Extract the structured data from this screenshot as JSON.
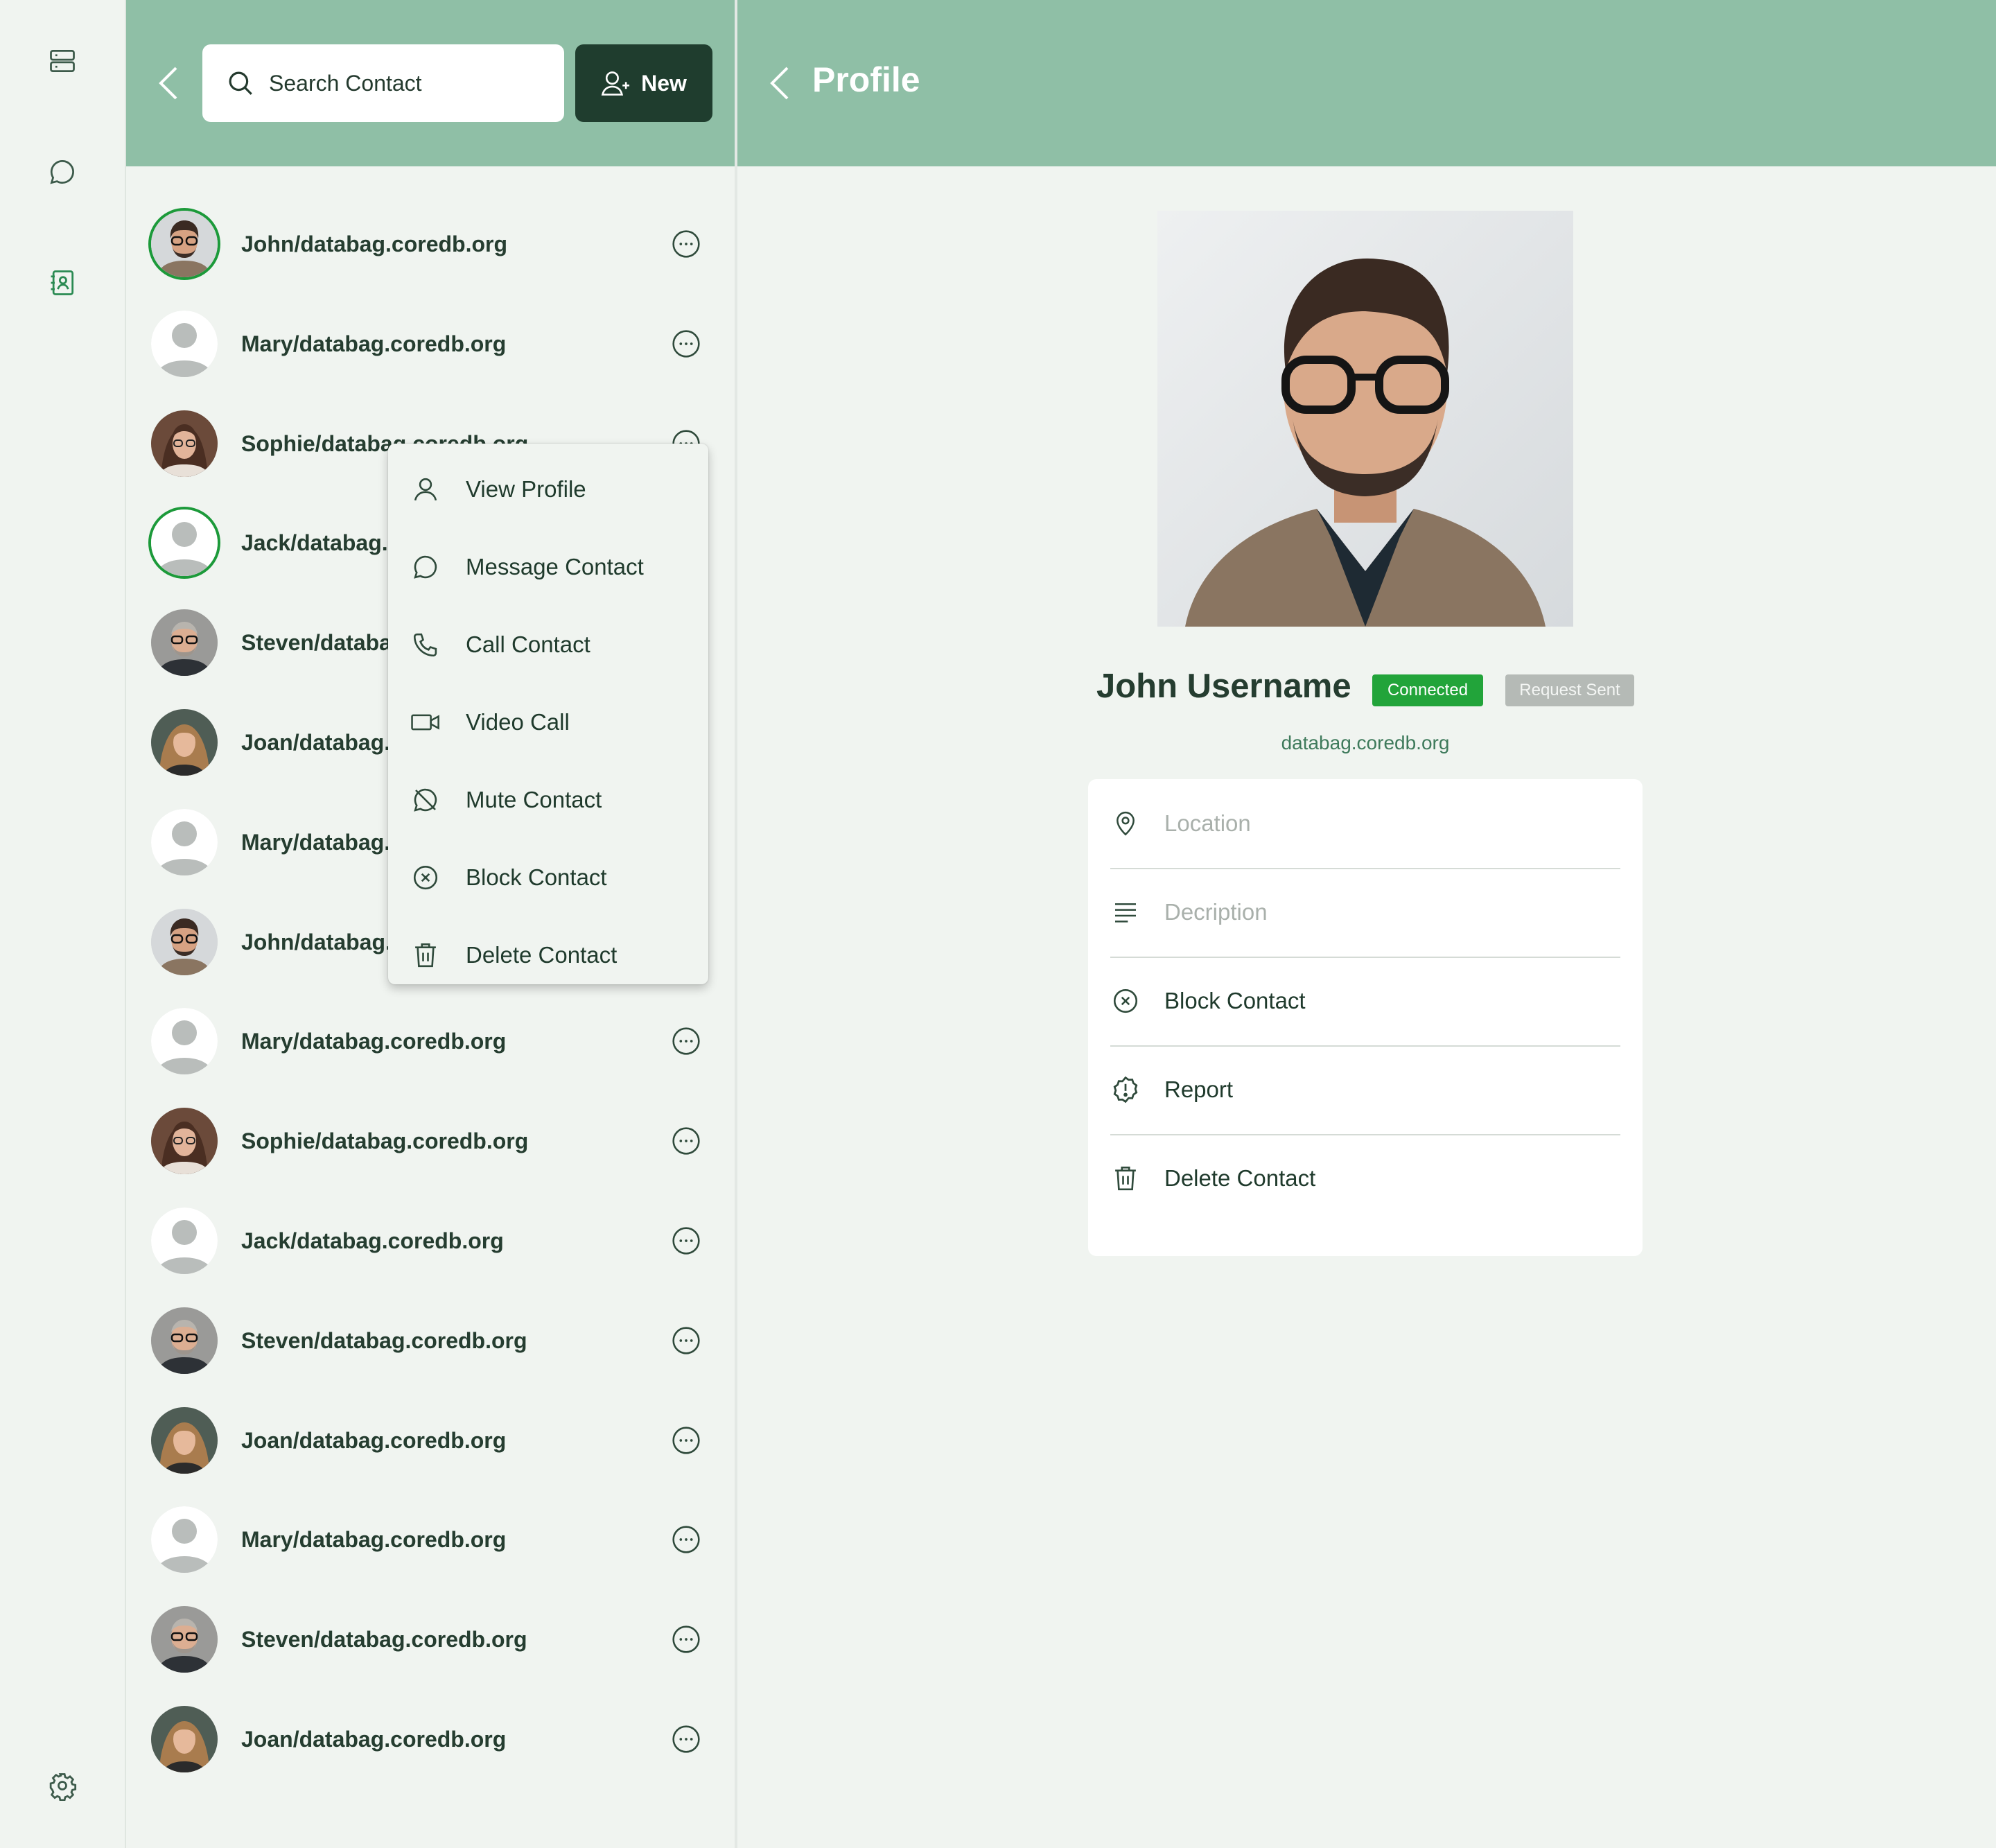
{
  "nav": {
    "icons": [
      "server-icon",
      "chat-bubble-icon",
      "contacts-book-icon",
      "gear-icon"
    ]
  },
  "contacts": {
    "search_placeholder": "Search Contact",
    "new_label": "New",
    "items": [
      {
        "name": "John/databag.coredb.org",
        "avatar": "photo-john",
        "connected": true
      },
      {
        "name": "Mary/databag.coredb.org",
        "avatar": "placeholder",
        "connected": false
      },
      {
        "name": "Sophie/databag.coredb.org",
        "avatar": "photo-sophie",
        "connected": false
      },
      {
        "name": "Jack/databag.coredb.org",
        "avatar": "placeholder",
        "connected": true
      },
      {
        "name": "Steven/databag.coredb.org",
        "avatar": "photo-steven",
        "connected": false
      },
      {
        "name": "Joan/databag.coredb.org",
        "avatar": "photo-joan",
        "connected": false
      },
      {
        "name": "Mary/databag.coredb.org",
        "avatar": "placeholder",
        "connected": false
      },
      {
        "name": "John/databag.coredb.org",
        "avatar": "photo-john",
        "connected": false
      },
      {
        "name": "Mary/databag.coredb.org",
        "avatar": "placeholder",
        "connected": false
      },
      {
        "name": "Sophie/databag.coredb.org",
        "avatar": "photo-sophie",
        "connected": false
      },
      {
        "name": "Jack/databag.coredb.org",
        "avatar": "placeholder",
        "connected": false
      },
      {
        "name": "Steven/databag.coredb.org",
        "avatar": "photo-steven",
        "connected": false
      },
      {
        "name": "Joan/databag.coredb.org",
        "avatar": "photo-joan",
        "connected": false
      },
      {
        "name": "Mary/databag.coredb.org",
        "avatar": "placeholder",
        "connected": false
      },
      {
        "name": "Steven/databag.coredb.org",
        "avatar": "photo-steven",
        "connected": false
      },
      {
        "name": "Joan/databag.coredb.org",
        "avatar": "photo-joan",
        "connected": false
      }
    ]
  },
  "menu": {
    "items": [
      {
        "label": "View Profile",
        "icon": "user-icon"
      },
      {
        "label": "Message Contact",
        "icon": "chat-bubble-icon"
      },
      {
        "label": "Call Contact",
        "icon": "phone-icon"
      },
      {
        "label": "Video Call",
        "icon": "video-camera-icon"
      },
      {
        "label": "Mute Contact",
        "icon": "mute-chat-icon"
      },
      {
        "label": "Block Contact",
        "icon": "x-circle-icon"
      },
      {
        "label": "Delete Contact",
        "icon": "trash-icon"
      }
    ]
  },
  "profile": {
    "header_title": "Profile",
    "name": "John Username",
    "badge_connected": "Connected",
    "badge_request": "Request Sent",
    "handle": "databag.coredb.org",
    "location_placeholder": "Location",
    "description_placeholder": "Decription",
    "block_label": "Block Contact",
    "report_label": "Report",
    "delete_label": "Delete Contact"
  },
  "colors": {
    "header": "#8fbfa6",
    "background": "#f0f4f0",
    "new_button": "#1f3d2e",
    "connected": "#22a43a",
    "request_sent": "#b5bab6",
    "handle_text": "#3e7a5b"
  }
}
